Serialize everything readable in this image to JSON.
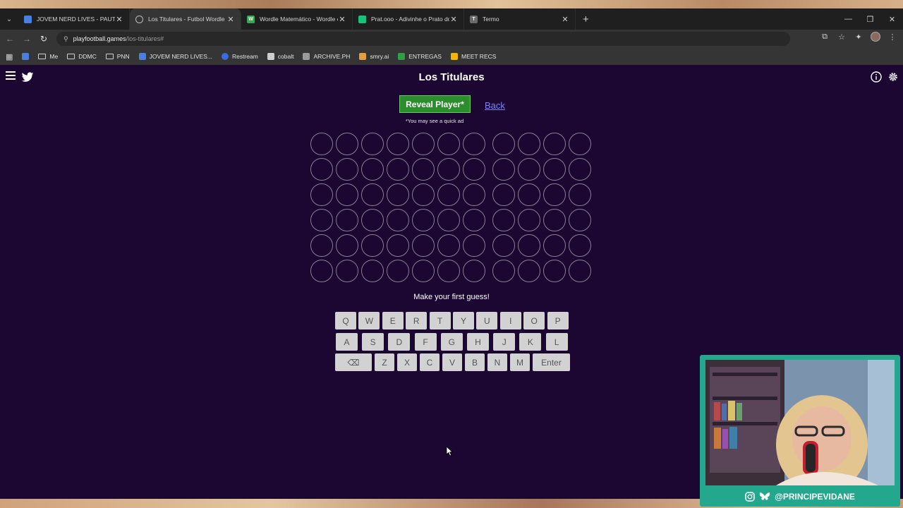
{
  "browser": {
    "tabs": [
      {
        "title": "JOVEM NERD LIVES - PAUTA - [",
        "icon": "docs-icon",
        "color": "#4a7fe0"
      },
      {
        "title": "Los Titulares - Futbol Wordle G",
        "icon": "globe-icon",
        "color": "#777777"
      },
      {
        "title": "Wordle Matemático - Wordle c",
        "icon": "wordle-icon",
        "color": "#3aa757",
        "letter": "W"
      },
      {
        "title": "Prat.ooo - Adivinhe o Prato do",
        "icon": "prato-icon",
        "color": "#18c27a"
      },
      {
        "title": "Termo",
        "icon": "termo-icon",
        "color": "#6b6b6b",
        "letter": "T"
      }
    ],
    "url_host": "playfootball.games",
    "url_path": "/los-titulares#",
    "bookmarks": [
      {
        "label": "",
        "icon": "calendar-icon"
      },
      {
        "label": "Me",
        "icon": "folder-icon"
      },
      {
        "label": "DDMC",
        "icon": "folder-icon"
      },
      {
        "label": "PNN",
        "icon": "folder-icon"
      },
      {
        "label": "JOVEM NERD LIVES...",
        "icon": "docs-icon"
      },
      {
        "label": "Restream",
        "icon": "restream-icon"
      },
      {
        "label": "cobalt",
        "icon": "cobalt-icon"
      },
      {
        "label": "ARCHIVE.PH",
        "icon": "archive-icon"
      },
      {
        "label": "smry.ai",
        "icon": "smry-icon"
      },
      {
        "label": "ENTREGAS",
        "icon": "sheets-icon"
      },
      {
        "label": "MEET RECS",
        "icon": "drive-icon"
      }
    ]
  },
  "page": {
    "title": "Los Titulares",
    "reveal_button": "Reveal Player*",
    "back_link": "Back",
    "ad_note": "*You may see a quick ad",
    "prompt": "Make your first guess!",
    "grid": {
      "rows": 6,
      "groups": [
        7,
        4
      ]
    },
    "keyboard": {
      "row1": [
        "Q",
        "W",
        "E",
        "R",
        "T",
        "Y",
        "U",
        "I",
        "O",
        "P"
      ],
      "row2": [
        "A",
        "S",
        "D",
        "F",
        "G",
        "H",
        "J",
        "K",
        "L"
      ],
      "row3": [
        "⌫",
        "Z",
        "X",
        "C",
        "V",
        "B",
        "N",
        "M",
        "Enter"
      ]
    }
  },
  "overlay": {
    "handle": "@PRINCIPEVIDANE"
  }
}
